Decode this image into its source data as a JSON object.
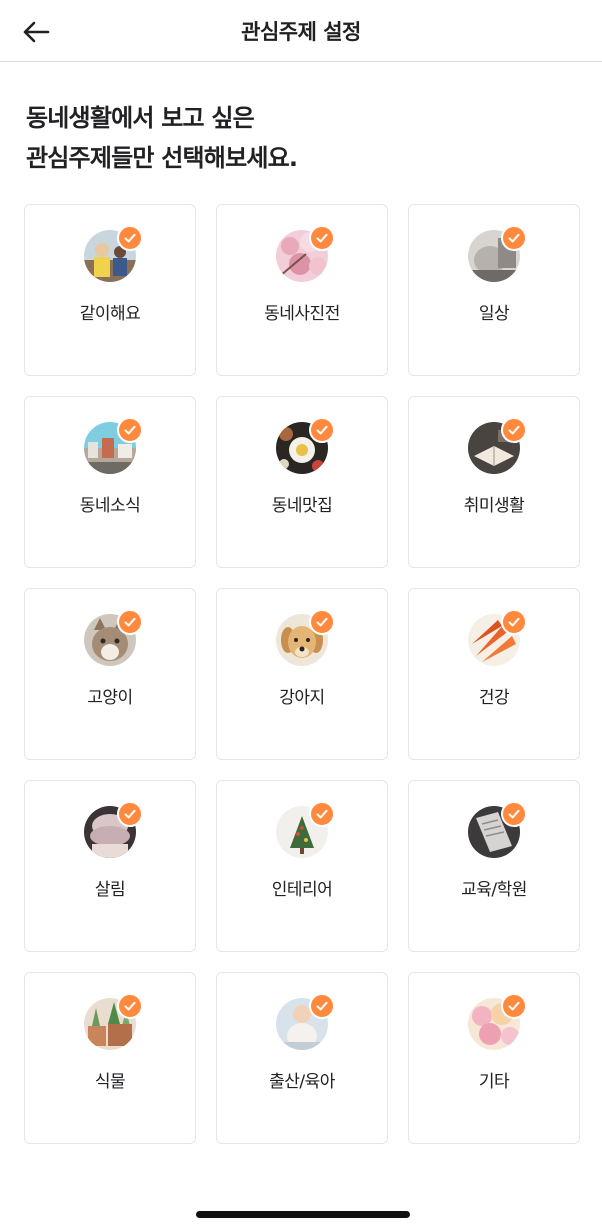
{
  "colors": {
    "accent": "#ff8a3d",
    "border": "#e6e6e6",
    "text": "#212124"
  },
  "header": {
    "title": "관심주제 설정",
    "back_icon": "arrow-left-icon"
  },
  "intro": {
    "line1": "동네생활에서 보고 싶은",
    "line2": "관심주제들만 선택해보세요."
  },
  "topics": [
    {
      "label": "같이해요",
      "selected": true
    },
    {
      "label": "동네사진전",
      "selected": true
    },
    {
      "label": "일상",
      "selected": true
    },
    {
      "label": "동네소식",
      "selected": true
    },
    {
      "label": "동네맛집",
      "selected": true
    },
    {
      "label": "취미생활",
      "selected": true
    },
    {
      "label": "고양이",
      "selected": true
    },
    {
      "label": "강아지",
      "selected": true
    },
    {
      "label": "건강",
      "selected": true
    },
    {
      "label": "살림",
      "selected": true
    },
    {
      "label": "인테리어",
      "selected": true
    },
    {
      "label": "교육/학원",
      "selected": true
    },
    {
      "label": "식물",
      "selected": true
    },
    {
      "label": "출산/육아",
      "selected": true
    },
    {
      "label": "기타",
      "selected": true
    }
  ]
}
